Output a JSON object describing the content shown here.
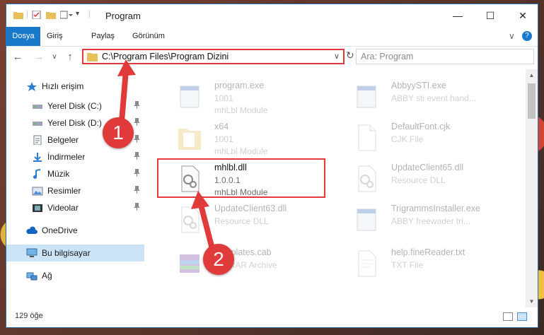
{
  "titlebar": {
    "title": "Program",
    "min_glyph": "—",
    "max_glyph": "☐",
    "close_glyph": "✕"
  },
  "ribbon": {
    "tabs": [
      "Dosya",
      "Giriş",
      "Paylaş",
      "Görünüm"
    ],
    "active_tab": "Dosya",
    "expand_glyph": "∨",
    "help_glyph": "?"
  },
  "nav": {
    "back": "←",
    "forward": "→",
    "recent": "∨",
    "up": "↑",
    "address": "C:\\Program Files\\Program Dizini",
    "refresh_glyph": "↻",
    "dropdown_glyph": "∨",
    "search_placeholder": "Ara: Program"
  },
  "sidebar": {
    "items": [
      {
        "label": "Hızlı erişim",
        "icon": "star-icon",
        "pinned": false
      },
      {
        "label": "Yerel Disk (C:)",
        "icon": "drive-icon",
        "pinned": true
      },
      {
        "label": "Yerel Disk (D:)",
        "icon": "drive-icon",
        "pinned": true
      },
      {
        "label": "Belgeler",
        "icon": "documents-icon",
        "pinned": true
      },
      {
        "label": "İndirmeler",
        "icon": "download-icon",
        "pinned": true
      },
      {
        "label": "Müzik",
        "icon": "music-icon",
        "pinned": true
      },
      {
        "label": "Resimler",
        "icon": "pictures-icon",
        "pinned": true
      },
      {
        "label": "Videolar",
        "icon": "videos-icon",
        "pinned": true
      },
      {
        "label": "OneDrive",
        "icon": "cloud-icon",
        "pinned": false
      },
      {
        "label": "Bu bilgisayar",
        "icon": "computer-icon",
        "pinned": false,
        "selected": true
      },
      {
        "label": "Ağ",
        "icon": "network-icon",
        "pinned": false
      }
    ],
    "pin_glyph": "📌"
  },
  "files": [
    {
      "name": "program.exe",
      "line2": "1001",
      "line3": "mhLbl Module",
      "icon": "exe-icon",
      "faded": true
    },
    {
      "name": "AbbyySTI.exe",
      "line2": "ABBY sti event hand...",
      "line3": "",
      "icon": "exe-icon",
      "faded": true
    },
    {
      "name": "x64",
      "line2": "1001",
      "line3": "mhLbl Module",
      "icon": "folder-icon",
      "faded": true
    },
    {
      "name": "DefaultFont.cjk",
      "line2": "CJK File",
      "line3": "",
      "icon": "file-icon",
      "faded": true
    },
    {
      "name": "mhlbl.dll",
      "line2": "1.0.0.1",
      "line3": "mhLbl Module",
      "icon": "dll-icon",
      "faded": false
    },
    {
      "name": "UpdateClient65.dll",
      "line2": "Resource DLL",
      "line3": "",
      "icon": "dll-icon",
      "faded": true
    },
    {
      "name": "UpdateClient63.dll",
      "line2": "Resource DLL",
      "line3": "",
      "icon": "dll-icon",
      "faded": true
    },
    {
      "name": "TrigrammsInstaller.exe",
      "line2": "ABBY freewader tri...",
      "line3": "",
      "icon": "exe-icon",
      "faded": true
    },
    {
      "name": "Templates.cab",
      "line2": "WinRAR Archive",
      "line3": "",
      "icon": "archive-icon",
      "faded": true
    },
    {
      "name": "help.fineReader.txt",
      "line2": "TXT File",
      "line3": "",
      "icon": "text-file-icon",
      "faded": true
    }
  ],
  "status": {
    "item_count": "129 öğe"
  },
  "callouts": [
    "1",
    "2"
  ],
  "colors": {
    "accent": "#1979ca",
    "highlight": "#e03a3a",
    "selected": "#cce4f7"
  }
}
